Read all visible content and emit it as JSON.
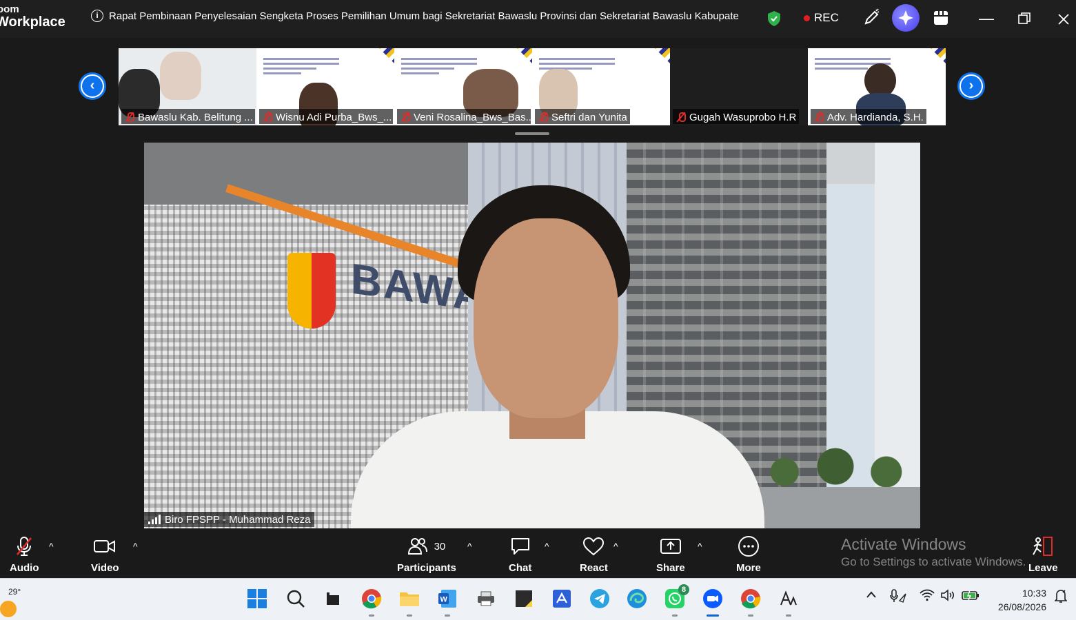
{
  "app": {
    "brand_line1": "oom",
    "brand_line2": "Workplace",
    "meeting_title": "Rapat Pembinaan Penyelesaian Sengketa Proses Pemilihan Umum bagi Sekretariat Bawaslu Provinsi dan Sekretariat Bawaslu Kabupaten/Ko",
    "rec_label": "REC"
  },
  "filmstrip": {
    "tiles": [
      {
        "name": "Bawaslu Kab. Belitung ..."
      },
      {
        "name": "Wisnu Adi Purba_Bws_..."
      },
      {
        "name": "Veni Rosalina_Bws_Bas..."
      },
      {
        "name": "Seftri dan Yunita"
      },
      {
        "name": "Gugah Wasuprobo H.R"
      },
      {
        "name": "Adv. Hardianda, S.H."
      }
    ]
  },
  "main_video": {
    "speaker_name": "Biro FPSPP - Muhammad Reza",
    "background_logo_text": "BAWASLU"
  },
  "toolbar": {
    "audio_label": "Audio",
    "video_label": "Video",
    "participants_label": "Participants",
    "participants_count": "30",
    "chat_label": "Chat",
    "react_label": "React",
    "share_label": "Share",
    "more_label": "More",
    "leave_label": "Leave"
  },
  "watermark": {
    "line1": "Activate Windows",
    "line2": "Go to Settings to activate Windows."
  },
  "taskbar": {
    "temperature": "29°",
    "whatsapp_badge": "8",
    "time": "10:33",
    "date": "26/08/2026"
  },
  "colors": {
    "zoom_blue": "#0e72ed",
    "rec_red": "#e02020",
    "shield_green": "#2fb24c",
    "muted_red": "#e02b2b"
  }
}
